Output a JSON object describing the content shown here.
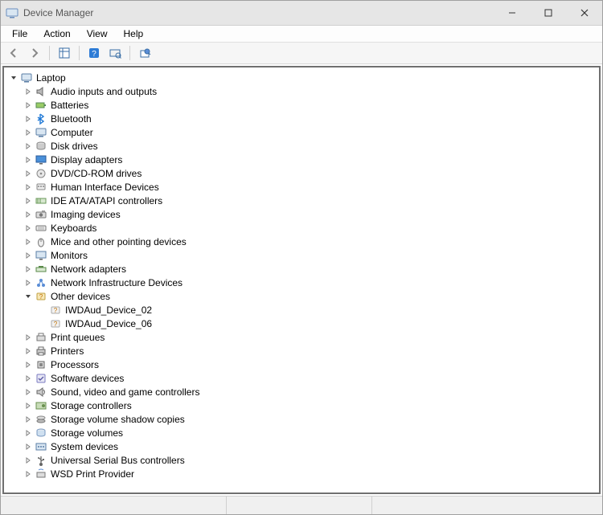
{
  "window": {
    "title": "Device Manager"
  },
  "menu": {
    "file": "File",
    "action": "Action",
    "view": "View",
    "help": "Help"
  },
  "toolbar": {
    "back": "back-icon",
    "forward": "forward-icon",
    "show_hide": "show-hide-tree-icon",
    "help": "help-icon",
    "scan": "scan-hardware-icon",
    "properties": "properties-icon"
  },
  "tree": {
    "root": {
      "label": "Laptop",
      "expanded": true,
      "icon": "computer",
      "children": [
        {
          "label": "Audio inputs and outputs",
          "icon": "audio",
          "expandable": true
        },
        {
          "label": "Batteries",
          "icon": "battery",
          "expandable": true
        },
        {
          "label": "Bluetooth",
          "icon": "bluetooth",
          "expandable": true
        },
        {
          "label": "Computer",
          "icon": "computer",
          "expandable": true
        },
        {
          "label": "Disk drives",
          "icon": "disk",
          "expandable": true
        },
        {
          "label": "Display adapters",
          "icon": "display",
          "expandable": true
        },
        {
          "label": "DVD/CD-ROM drives",
          "icon": "optical",
          "expandable": true
        },
        {
          "label": "Human Interface Devices",
          "icon": "hid",
          "expandable": true
        },
        {
          "label": "IDE ATA/ATAPI controllers",
          "icon": "ide",
          "expandable": true
        },
        {
          "label": "Imaging devices",
          "icon": "imaging",
          "expandable": true
        },
        {
          "label": "Keyboards",
          "icon": "keyboard",
          "expandable": true
        },
        {
          "label": "Mice and other pointing devices",
          "icon": "mouse",
          "expandable": true
        },
        {
          "label": "Monitors",
          "icon": "monitor",
          "expandable": true
        },
        {
          "label": "Network adapters",
          "icon": "network",
          "expandable": true
        },
        {
          "label": "Network Infrastructure Devices",
          "icon": "netinfra",
          "expandable": true
        },
        {
          "label": "Other devices",
          "icon": "other",
          "expandable": true,
          "expanded": true,
          "children": [
            {
              "label": "IWDAud_Device_02",
              "icon": "unknown",
              "expandable": false
            },
            {
              "label": "IWDAud_Device_06",
              "icon": "unknown",
              "expandable": false
            }
          ]
        },
        {
          "label": "Print queues",
          "icon": "printq",
          "expandable": true
        },
        {
          "label": "Printers",
          "icon": "printer",
          "expandable": true
        },
        {
          "label": "Processors",
          "icon": "cpu",
          "expandable": true
        },
        {
          "label": "Software devices",
          "icon": "software",
          "expandable": true
        },
        {
          "label": "Sound, video and game controllers",
          "icon": "sound",
          "expandable": true
        },
        {
          "label": "Storage controllers",
          "icon": "storage",
          "expandable": true
        },
        {
          "label": "Storage volume shadow copies",
          "icon": "shadow",
          "expandable": true
        },
        {
          "label": "Storage volumes",
          "icon": "volume",
          "expandable": true
        },
        {
          "label": "System devices",
          "icon": "system",
          "expandable": true
        },
        {
          "label": "Universal Serial Bus controllers",
          "icon": "usb",
          "expandable": true
        },
        {
          "label": "WSD Print Provider",
          "icon": "wsd",
          "expandable": true
        }
      ]
    }
  }
}
